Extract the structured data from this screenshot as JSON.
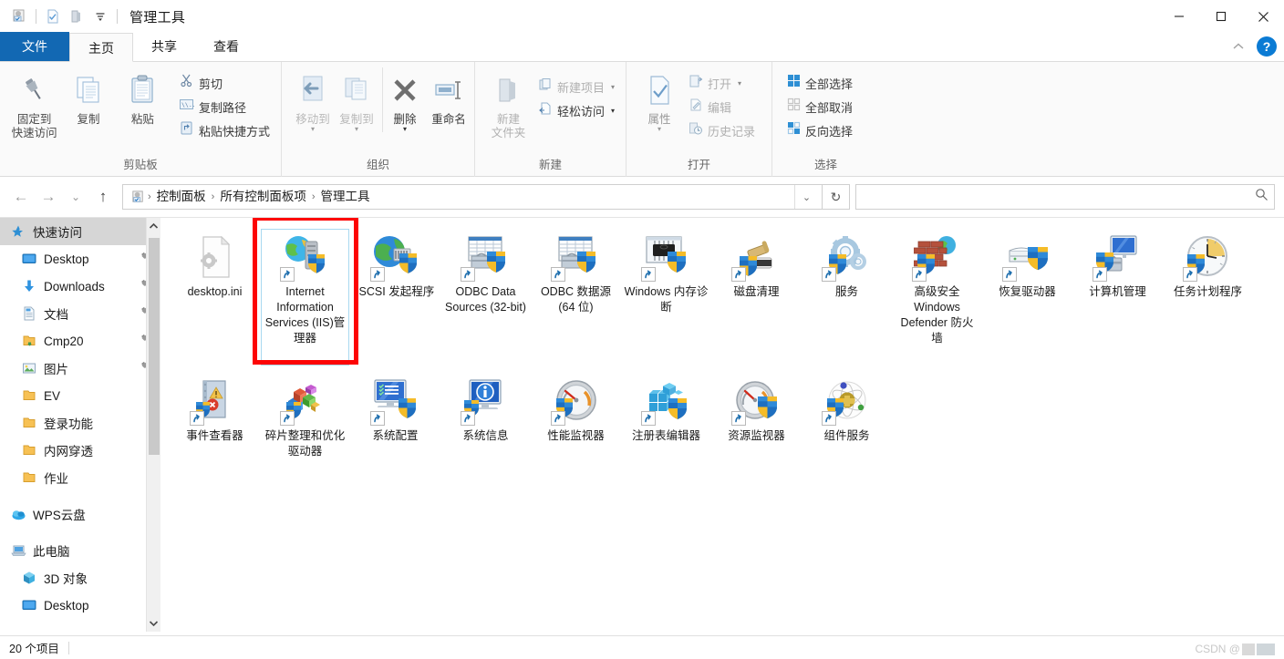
{
  "window": {
    "title": "管理工具",
    "minimize_label": "—",
    "maximize_label": "□",
    "close_label": "✕",
    "collapse_ribbon_label": "︿",
    "help_label": "?"
  },
  "quick_access": {
    "items": [
      {
        "name": "control-panel-icon",
        "label": ""
      },
      {
        "name": "properties-icon",
        "label": ""
      },
      {
        "name": "new-folder-icon",
        "label": ""
      },
      {
        "name": "customize-dropdown-icon",
        "label": "▾"
      }
    ]
  },
  "tabs": [
    {
      "id": "file",
      "label": "文件",
      "style": "file"
    },
    {
      "id": "home",
      "label": "主页",
      "style": "active"
    },
    {
      "id": "share",
      "label": "共享",
      "style": "normal"
    },
    {
      "id": "view",
      "label": "查看",
      "style": "normal"
    }
  ],
  "ribbon": {
    "groups": [
      {
        "label": "剪贴板",
        "big": [
          {
            "name": "pin-to-quick-access-button",
            "label": "固定到\n快速访问",
            "icon": "pin"
          },
          {
            "name": "copy-button",
            "label": "复制",
            "icon": "copy"
          },
          {
            "name": "paste-button",
            "label": "粘贴",
            "icon": "paste"
          }
        ],
        "small": [
          {
            "name": "cut-button",
            "label": "剪切",
            "icon": "scissors",
            "dim": false
          },
          {
            "name": "copy-path-button",
            "label": "复制路径",
            "icon": "path",
            "dim": false
          },
          {
            "name": "paste-shortcut-button",
            "label": "粘贴快捷方式",
            "icon": "paste-sc",
            "dim": false
          }
        ]
      },
      {
        "label": "组织",
        "big": [
          {
            "name": "move-to-button",
            "label": "移动到",
            "icon": "move-to",
            "dim": true,
            "caret": true
          },
          {
            "name": "copy-to-button",
            "label": "复制到",
            "icon": "copy-to",
            "dim": true,
            "caret": true
          },
          {
            "name": "delete-button",
            "label": "删除",
            "icon": "delete",
            "caret": true
          },
          {
            "name": "rename-button",
            "label": "重命名",
            "icon": "rename"
          }
        ],
        "small": []
      },
      {
        "label": "新建",
        "big": [
          {
            "name": "new-folder-button",
            "label": "新建\n文件夹",
            "icon": "folder",
            "dim": true
          }
        ],
        "small": [
          {
            "name": "new-item-button",
            "label": "新建项目",
            "icon": "new-item",
            "caret": true,
            "dim": true
          },
          {
            "name": "easy-access-button",
            "label": "轻松访问",
            "icon": "easy-access",
            "caret": true,
            "dim": false
          }
        ]
      },
      {
        "label": "打开",
        "big": [
          {
            "name": "properties-button",
            "label": "属性",
            "icon": "properties",
            "dim": true,
            "caret": true
          }
        ],
        "small": [
          {
            "name": "open-button",
            "label": "打开",
            "icon": "open",
            "caret": true,
            "dim": true
          },
          {
            "name": "edit-button",
            "label": "编辑",
            "icon": "edit",
            "dim": true
          },
          {
            "name": "history-button",
            "label": "历史记录",
            "icon": "history",
            "dim": true
          }
        ]
      },
      {
        "label": "选择",
        "big": [],
        "small": [
          {
            "name": "select-all-button",
            "label": "全部选择",
            "icon": "select-all",
            "dim": false
          },
          {
            "name": "select-none-button",
            "label": "全部取消",
            "icon": "select-none",
            "dim": false
          },
          {
            "name": "invert-selection-button",
            "label": "反向选择",
            "icon": "invert",
            "dim": false
          }
        ]
      }
    ]
  },
  "nav": {
    "back_label": "←",
    "forward_label": "→",
    "recent_label": "⌄",
    "up_label": "↑",
    "breadcrumbs": [
      "控制面板",
      "所有控制面板项",
      "管理工具"
    ],
    "breadcrumb_separator": "›",
    "address_dropdown_label": "⌄",
    "refresh_label": "↻",
    "search_value": "",
    "search_placeholder": "",
    "search_icon_label": "⌕"
  },
  "sidebar": {
    "scroll_up_label": "⌃",
    "scroll_down_label": "⌄",
    "items": [
      {
        "label": "快速访问",
        "icon": "star-icon",
        "name": "sidebar-item-quick-access",
        "level": 0,
        "selected": true,
        "pinned": false
      },
      {
        "label": "Desktop",
        "icon": "desktop-icon",
        "name": "sidebar-item-desktop",
        "level": 1,
        "selected": false,
        "pinned": true
      },
      {
        "label": "Downloads",
        "icon": "download-icon",
        "name": "sidebar-item-downloads",
        "level": 1,
        "selected": false,
        "pinned": true
      },
      {
        "label": "文档",
        "icon": "document-icon",
        "name": "sidebar-item-documents",
        "level": 1,
        "selected": false,
        "pinned": true
      },
      {
        "label": "Cmp20",
        "icon": "folder-down-icon",
        "name": "sidebar-item-cmp20",
        "level": 1,
        "selected": false,
        "pinned": true
      },
      {
        "label": "图片",
        "icon": "pictures-icon",
        "name": "sidebar-item-pictures",
        "level": 1,
        "selected": false,
        "pinned": true
      },
      {
        "label": "EV",
        "icon": "folder-icon",
        "name": "sidebar-item-ev",
        "level": 1,
        "selected": false,
        "pinned": false
      },
      {
        "label": "登录功能",
        "icon": "folder-icon",
        "name": "sidebar-item-login-feature",
        "level": 1,
        "selected": false,
        "pinned": false
      },
      {
        "label": "内网穿透",
        "icon": "folder-icon",
        "name": "sidebar-item-intranet",
        "level": 1,
        "selected": false,
        "pinned": false
      },
      {
        "label": "作业",
        "icon": "folder-icon",
        "name": "sidebar-item-homework",
        "level": 1,
        "selected": false,
        "pinned": false
      },
      {
        "label": "WPS云盘",
        "icon": "cloud-icon",
        "name": "sidebar-item-wps-cloud",
        "level": 0,
        "selected": false,
        "pinned": false,
        "gap_before": true
      },
      {
        "label": "此电脑",
        "icon": "computer-icon",
        "name": "sidebar-item-this-pc",
        "level": 0,
        "selected": false,
        "pinned": false,
        "gap_before": true
      },
      {
        "label": "3D 对象",
        "icon": "cube-icon",
        "name": "sidebar-item-3d-objects",
        "level": 1,
        "selected": false,
        "pinned": false
      },
      {
        "label": "Desktop",
        "icon": "desktop-icon",
        "name": "sidebar-item-pc-desktop",
        "level": 1,
        "selected": false,
        "pinned": false
      }
    ]
  },
  "files": [
    {
      "label": "desktop.ini",
      "icon": "ini-file-icon",
      "name": "file-desktop-ini",
      "shortcut": false,
      "selected": false
    },
    {
      "label": "Internet Information Services (IIS)管理器",
      "icon": "iis-manager-icon",
      "name": "file-iis-manager",
      "shortcut": true,
      "selected": true
    },
    {
      "label": "iSCSI 发起程序",
      "icon": "iscsi-initiator-icon",
      "name": "file-iscsi-initiator",
      "shortcut": true,
      "selected": false
    },
    {
      "label": "ODBC Data Sources (32-bit)",
      "icon": "odbc-32-icon",
      "name": "file-odbc-32bit",
      "shortcut": true,
      "selected": false
    },
    {
      "label": "ODBC 数据源(64 位)",
      "icon": "odbc-64-icon",
      "name": "file-odbc-64bit",
      "shortcut": true,
      "selected": false
    },
    {
      "label": "Windows 内存诊断",
      "icon": "memory-diagnostic-icon",
      "name": "file-windows-memory-diag",
      "shortcut": true,
      "selected": false
    },
    {
      "label": "磁盘清理",
      "icon": "disk-cleanup-icon",
      "name": "file-disk-cleanup",
      "shortcut": true,
      "selected": false
    },
    {
      "label": "服务",
      "icon": "services-icon",
      "name": "file-services",
      "shortcut": true,
      "selected": false
    },
    {
      "label": "高级安全 Windows Defender 防火墙",
      "icon": "firewall-icon",
      "name": "file-windows-defender-firewall",
      "shortcut": true,
      "selected": false
    },
    {
      "label": "恢复驱动器",
      "icon": "recovery-drive-icon",
      "name": "file-recovery-drive",
      "shortcut": true,
      "selected": false
    },
    {
      "label": "计算机管理",
      "icon": "computer-mgmt-icon",
      "name": "file-computer-management",
      "shortcut": true,
      "selected": false
    },
    {
      "label": "任务计划程序",
      "icon": "task-scheduler-icon",
      "name": "file-task-scheduler",
      "shortcut": true,
      "selected": false
    },
    {
      "label": "事件查看器",
      "icon": "event-viewer-icon",
      "name": "file-event-viewer",
      "shortcut": true,
      "selected": false
    },
    {
      "label": "碎片整理和优化驱动器",
      "icon": "defrag-icon",
      "name": "file-defragment",
      "shortcut": true,
      "selected": false
    },
    {
      "label": "系统配置",
      "icon": "system-config-icon",
      "name": "file-system-configuration",
      "shortcut": true,
      "selected": false
    },
    {
      "label": "系统信息",
      "icon": "system-info-icon",
      "name": "file-system-information",
      "shortcut": true,
      "selected": false
    },
    {
      "label": "性能监视器",
      "icon": "perf-monitor-icon",
      "name": "file-performance-monitor",
      "shortcut": true,
      "selected": false
    },
    {
      "label": "注册表编辑器",
      "icon": "registry-editor-icon",
      "name": "file-registry-editor",
      "shortcut": true,
      "selected": false
    },
    {
      "label": "资源监视器",
      "icon": "resource-monitor-icon",
      "name": "file-resource-monitor",
      "shortcut": true,
      "selected": false
    },
    {
      "label": "组件服务",
      "icon": "component-services-icon",
      "name": "file-component-services",
      "shortcut": true,
      "selected": false
    }
  ],
  "status": {
    "item_count": "20 个项目"
  },
  "watermark": {
    "text": "CSDN @"
  },
  "colors": {
    "file_tab_blue": "#1268b3",
    "highlight_red": "#fd0505",
    "selection_blue": "#a8d8f0",
    "sidebar_selected": "#d6d6d6",
    "help_blue": "#0b7bd4"
  }
}
